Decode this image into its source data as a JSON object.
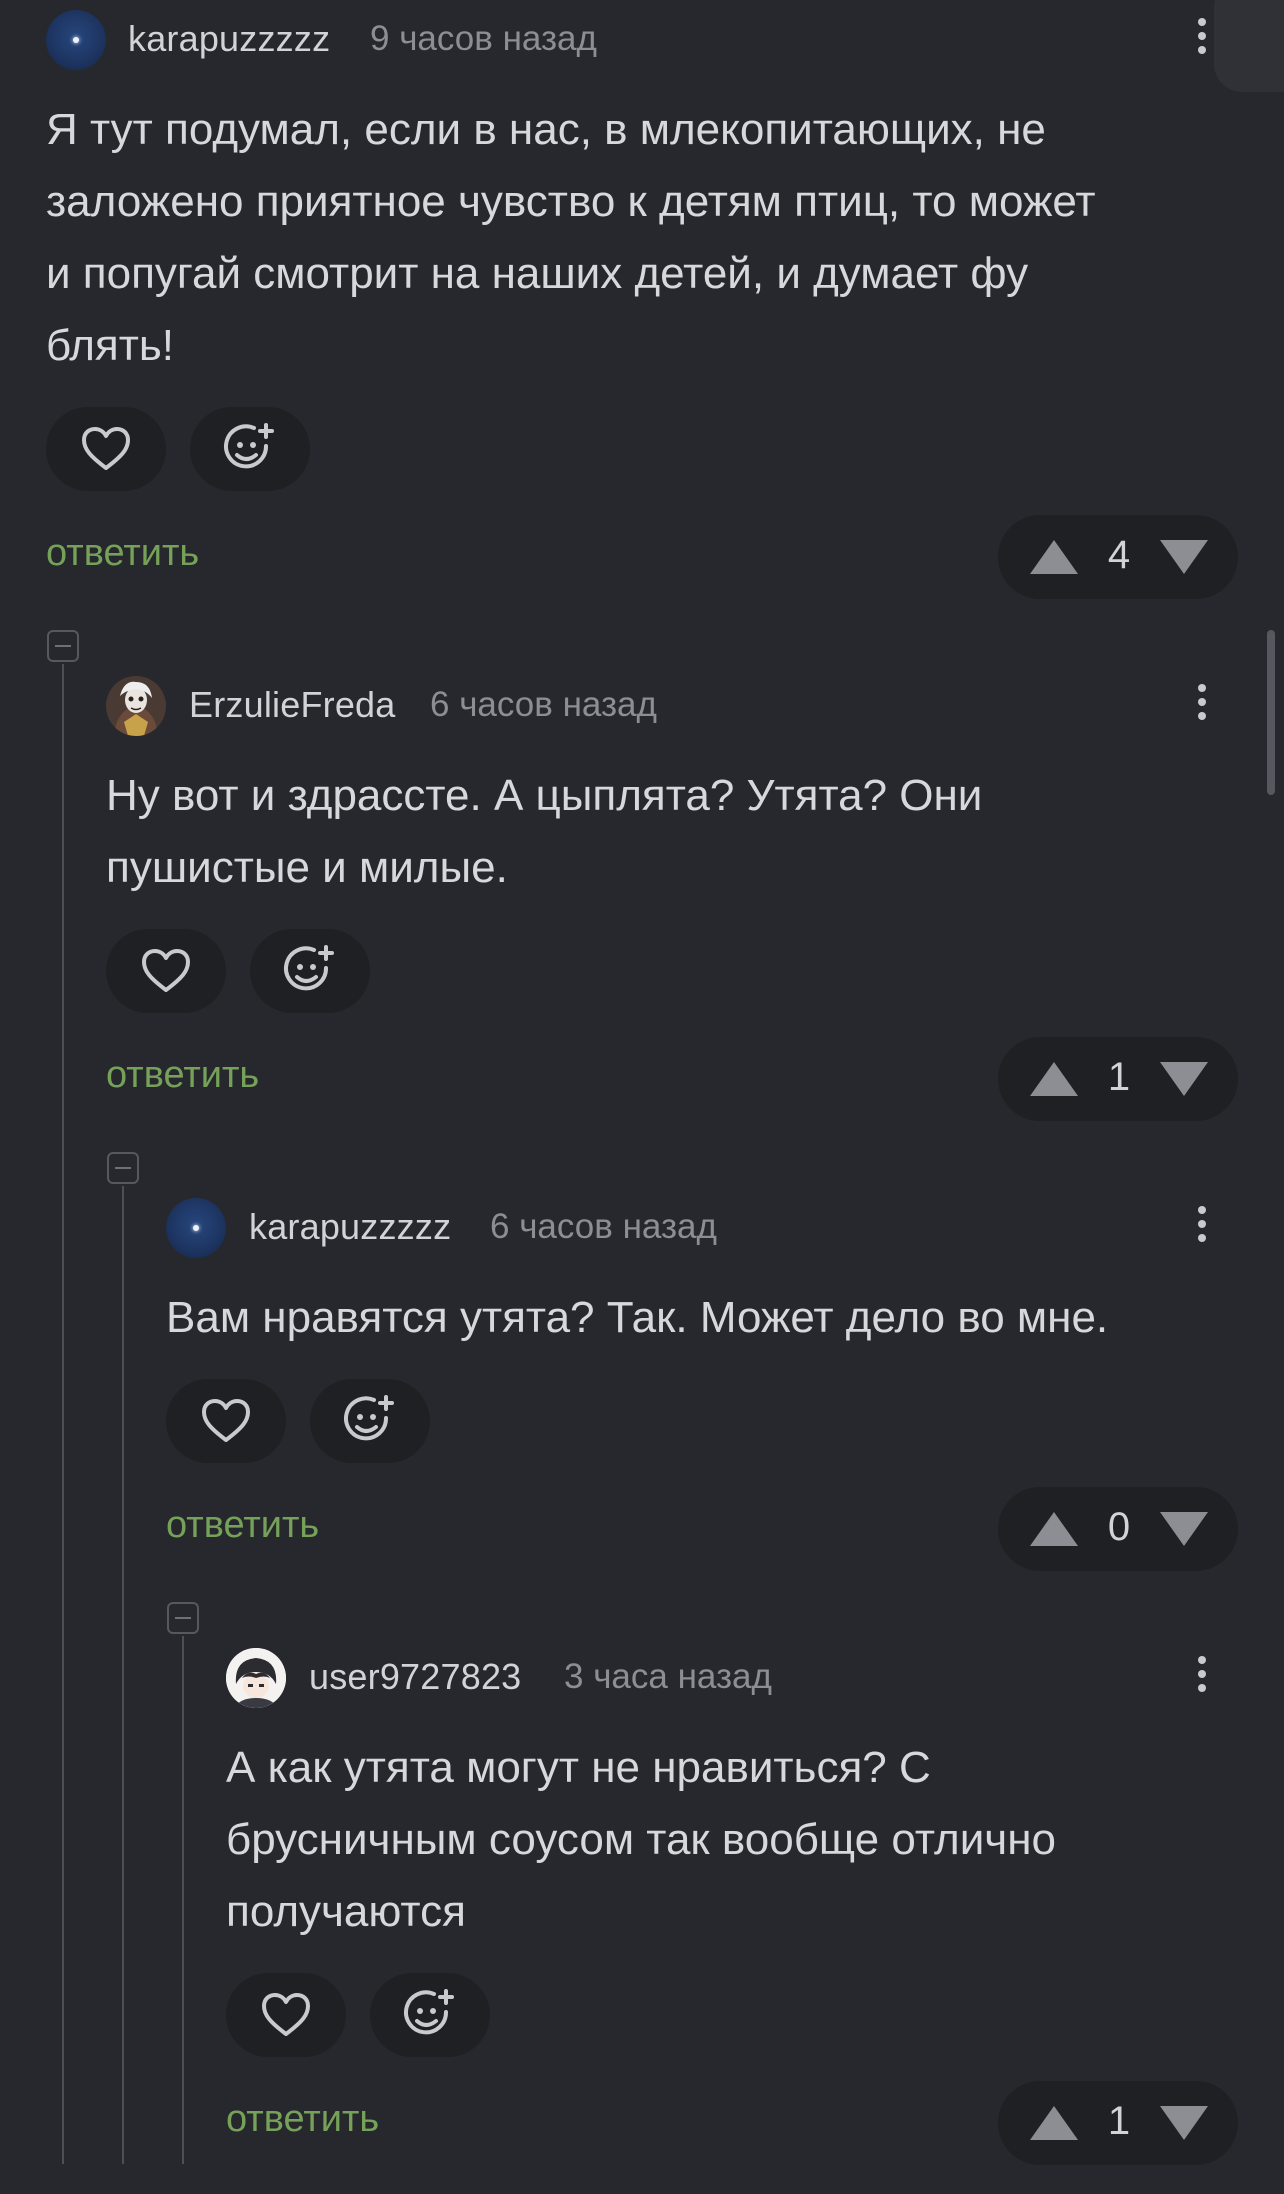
{
  "comments": [
    {
      "username": "karapuzzzzz",
      "time": "9 часов назад",
      "text": "Я тут подумал, если в нас, в млекопитающих, не\nзаложено приятное чувство к детям птиц, то может\nи попугай смотрит на наших детей, и думает фу\nблять!",
      "reply_label": "ответить",
      "rating": "4",
      "avatar": "night-sky-avatar"
    },
    {
      "username": "ErzulieFreda",
      "time": "6 часов назад",
      "text": "Ну вот и здрассте. А цыплята? Утята? Они\nпушистые и милые.",
      "reply_label": "ответить",
      "rating": "1",
      "avatar": "portrait-avatar"
    },
    {
      "username": "karapuzzzzz",
      "time": "6 часов назад",
      "text": "Вам нравятся утята? Так. Может дело во мне.",
      "reply_label": "ответить",
      "rating": "0",
      "avatar": "night-sky-avatar"
    },
    {
      "username": "user9727823",
      "time": "3 часа назад",
      "text": "А как утята могут не нравиться? С\nбрусничным соусом так вообще отлично\nполучаются",
      "reply_label": "ответить",
      "rating": "1",
      "avatar": "anime-character-avatar"
    }
  ],
  "icons": {
    "like": "heart-icon",
    "react": "smiley-plus-icon",
    "upvote": "triangle-up-icon",
    "downvote": "triangle-down-icon",
    "menu": "more-vertical-icon",
    "collapse": "minus-box-icon"
  },
  "colors": {
    "background": "#26282d",
    "button_bg": "#1f2024",
    "reply_link": "#76a158",
    "text": "#d7d8dc",
    "muted": "#8c8e93"
  }
}
